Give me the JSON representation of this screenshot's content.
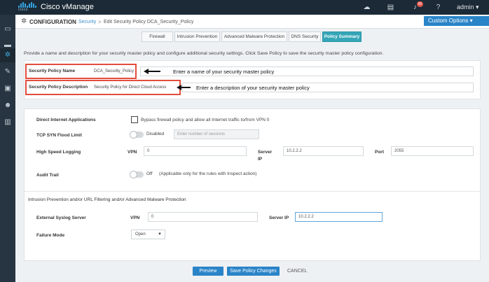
{
  "app": {
    "brand_word": "cisco",
    "title": "Cisco vManage",
    "notification_count": "65",
    "user_label": "admin ▾"
  },
  "header": {
    "section_title": "CONFIGURATION",
    "breadcrumb_link": "Security",
    "breadcrumb_sep": ">",
    "breadcrumb_current": "Edit Security Policy DCA_Security_Policy",
    "custom_options_label": "Custom Options ▾"
  },
  "tabs": [
    {
      "label": "Firewall"
    },
    {
      "label": "Intrusion Prevention"
    },
    {
      "label": "Advanced Malware Protection"
    },
    {
      "label": "DNS Security"
    },
    {
      "label": "Policy Summary"
    }
  ],
  "intro_text": "Provide a name and description for your security master policy and configure additional security settings. Click Save Policy to save the security master policy configuration.",
  "policy": {
    "name_label": "Security Policy Name",
    "name_value": "DCA_Security_Policy",
    "desc_label": "Security Policy Description",
    "desc_value": "Security Policy for Direct Cloud Access",
    "name_note": "Enter a name of your security master policy",
    "desc_note": "Enter a description of your security master policy"
  },
  "settings": {
    "dia_label": "Direct Internet Applications",
    "dia_checkbox_text": "Bypass firewall policy and allow all Internet traffic to/from VPN 0",
    "tcp_label": "TCP SYN Flood Limit",
    "tcp_toggle_text": "Disabled",
    "tcp_placeholder": "Enter number of sessions",
    "hsl_label": "High Speed Logging",
    "vpn_label": "VPN",
    "hsl_vpn_value": "0",
    "server_label_1": "Server",
    "server_label_2": "IP",
    "hsl_server_ip": "10.2.2.2",
    "port_label": "Port",
    "hsl_port_value": "2055",
    "audit_label": "Audit Trail",
    "audit_toggle_text": "Off",
    "audit_note": "(Applicable only for the rules with Inspect action)"
  },
  "ips": {
    "section_title": "Intrusion Prevention and/or URL Filtering and/or Advanced Malware Protection",
    "syslog_label": "External Syslog Server",
    "vpn_label": "VPN",
    "syslog_vpn_value": "0",
    "server_ip_label": "Server IP",
    "syslog_server_ip": "10.2.2.2",
    "failure_label": "Failure Mode",
    "failure_value": "Open"
  },
  "footer": {
    "preview_label": "Preview",
    "save_label": "Save Policy Changes",
    "cancel_label": "CANCEL"
  },
  "colors": {
    "topbar": "#1b2a36",
    "sidebar": "#263541",
    "accent_blue": "#2a84c8",
    "active_tab": "#35a6b8",
    "highlight_red": "#e24d3c"
  }
}
